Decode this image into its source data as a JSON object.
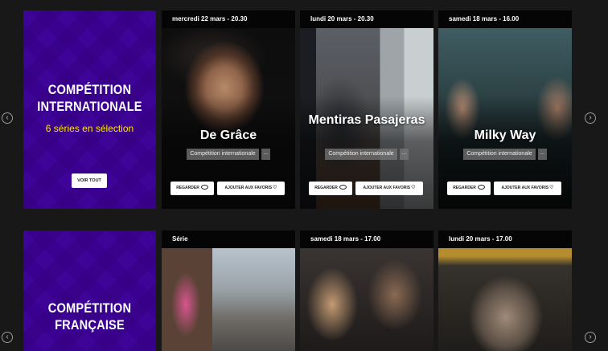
{
  "nav": {
    "prev_icon": "‹",
    "next_icon": "›"
  },
  "rows": [
    {
      "promo": {
        "title": "COMPÉTITION INTERNATIONALE",
        "subtitle": "6 séries en sélection",
        "button": "VOIR TOUT"
      },
      "cards": [
        {
          "date": "mercredi 22 mars - 20.30",
          "title": "De Grâce",
          "tag": "Compétition internationale",
          "more": "...",
          "watch": "REGARDER",
          "favorite": "AJOUTER AUX FAVORIS"
        },
        {
          "date": "lundi 20 mars - 20.30",
          "title": "Mentiras Pasajeras",
          "tag": "Compétition internationale",
          "more": "...",
          "watch": "REGARDER",
          "favorite": "AJOUTER AUX FAVORIS"
        },
        {
          "date": "samedi 18 mars - 16.00",
          "title": "Milky Way",
          "tag": "Compétition internationale",
          "more": "...",
          "watch": "REGARDER",
          "favorite": "AJOUTER AUX FAVORIS"
        }
      ]
    },
    {
      "promo": {
        "title": "COMPÉTITION FRANÇAISE"
      },
      "cards": [
        {
          "date": "Série"
        },
        {
          "date": "samedi 18 mars - 17.00"
        },
        {
          "date": "lundi 20 mars - 17.00"
        }
      ]
    }
  ]
}
